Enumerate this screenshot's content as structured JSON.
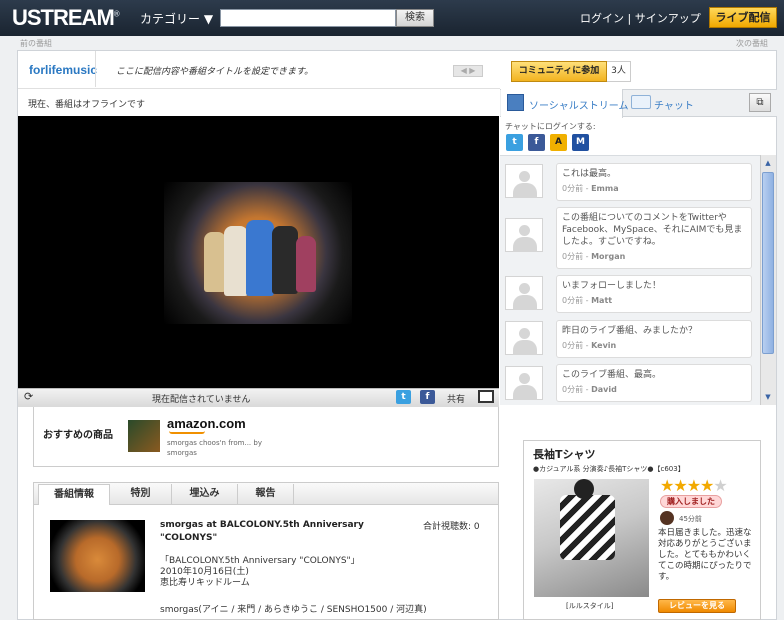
{
  "header": {
    "logo": "USTREAM",
    "logo_mark": "®",
    "category": "カテゴリー ▼",
    "search_value": "",
    "search_button": "検索",
    "login": "ログイン | サインアップ",
    "live_button": "ライブ配信"
  },
  "nav": {
    "prev": "前の番組",
    "next": "次の番組"
  },
  "channel": {
    "name": "forlifemusic",
    "description": "ここに配信内容や番組タイトルを設定できます。",
    "arrows": "◀ ▶",
    "offline": "現在、番組はオフラインです"
  },
  "player": {
    "refresh_icon": "refresh-icon",
    "status": "現在配信されていません",
    "twitter": "t",
    "facebook": "f",
    "share": "共有"
  },
  "recommend": {
    "title": "おすすめの商品",
    "brand": "amazon.com",
    "link": "smorgas choos'n from... by smorgas"
  },
  "tabs": [
    "番組情報",
    "特別",
    "埋込み",
    "報告"
  ],
  "info": {
    "title": "smorgas at BALCOLONY.5th Anniversary \"COLONYS\"",
    "views": "合計視聴数: 0",
    "desc": "「BALCOLONY.5th Anniversary \"COLONYS\"」\n2010年10月16日(土)\n恵比寿リキッドルーム",
    "members": "smorgas(アイニ / 来門 / あらきゆうこ / SENSHO1500 / 河辺真)"
  },
  "community": {
    "join": "コミュニティに参加",
    "count": "3人"
  },
  "social": {
    "tab_stream": "ソーシャルストリーム",
    "tab_chat": "チャット",
    "login_text": "チャットにログインする:",
    "comments": [
      {
        "text": "これは最高。",
        "time": "0分前",
        "user": "Emma"
      },
      {
        "text": "この番組についてのコメントをTwitterやFacebook、MySpace、それにAIMでも見ましたよ。すごいですね。",
        "time": "0分前",
        "user": "Morgan"
      },
      {
        "text": "いまフォローしました！",
        "time": "0分前",
        "user": "Matt"
      },
      {
        "text": "昨日のライブ番組、みましたか？",
        "time": "0分前",
        "user": "Kevin"
      },
      {
        "text": "このライブ番組、最高。",
        "time": "0分前",
        "user": "David"
      }
    ]
  },
  "ad": {
    "title": "長袖Tシャツ",
    "subtitle": "●カジュアル系 分演奏♪長袖Tシャツ●【c603】",
    "caption": "[ルルスタイル]",
    "bought": "購入しました",
    "review_time": "45分前",
    "review": "本日届きました。迅速な対応ありがとうございました。とてももかわいくてこの時期にぴったりです。",
    "review_button": "レビューを見る",
    "stars_on": "★★★★",
    "stars_off": "★"
  },
  "colors": {
    "accent": "#f2b320",
    "link": "#3a7ec6",
    "topbar": "#1a2430"
  }
}
